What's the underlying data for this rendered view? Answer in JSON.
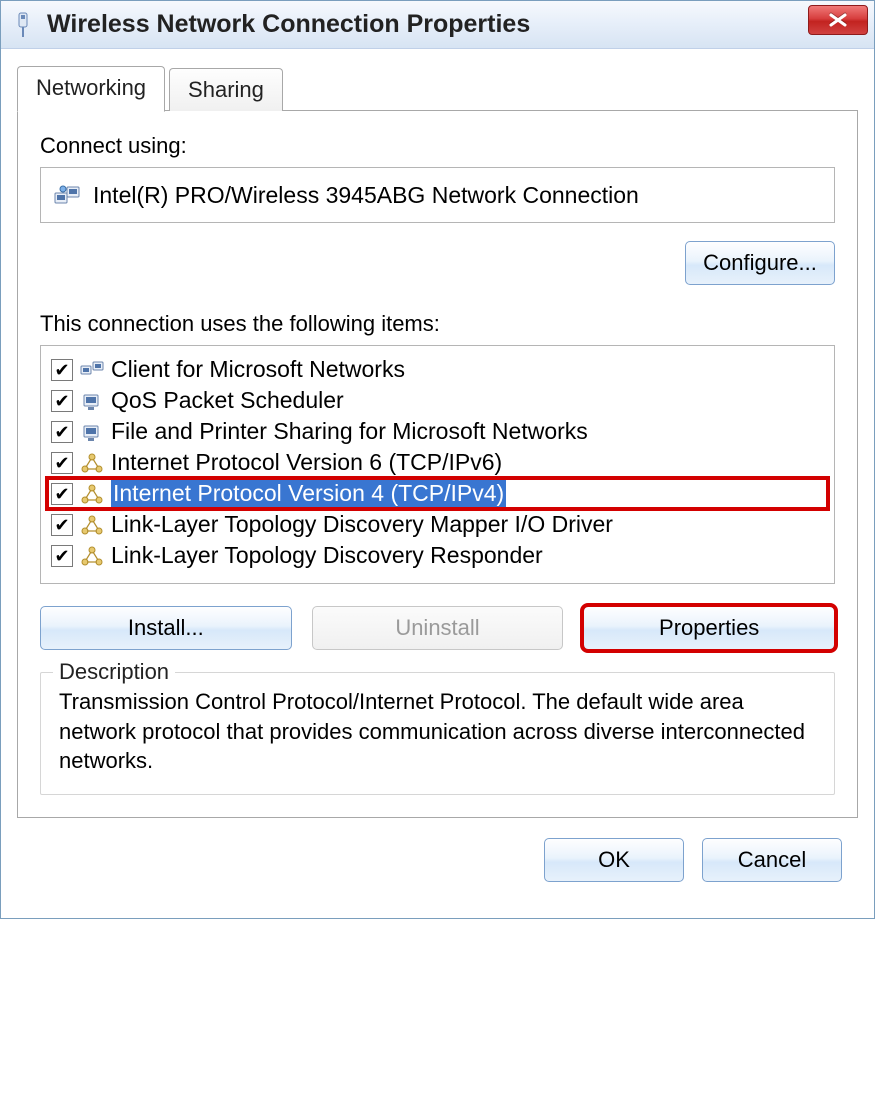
{
  "window": {
    "title": "Wireless Network Connection Properties"
  },
  "tabs": {
    "networking": "Networking",
    "sharing": "Sharing"
  },
  "connect_using_label": "Connect using:",
  "adapter_name": "Intel(R) PRO/Wireless 3945ABG Network Connection",
  "configure_label": "Configure...",
  "items_label": "This connection uses the following items:",
  "items": [
    {
      "label": "Client for Microsoft Networks",
      "checked": true,
      "icon": "client",
      "selected": false,
      "highlight": false
    },
    {
      "label": "QoS Packet Scheduler",
      "checked": true,
      "icon": "service",
      "selected": false,
      "highlight": false
    },
    {
      "label": "File and Printer Sharing for Microsoft Networks",
      "checked": true,
      "icon": "service",
      "selected": false,
      "highlight": false
    },
    {
      "label": "Internet Protocol Version 6 (TCP/IPv6)",
      "checked": true,
      "icon": "protocol",
      "selected": false,
      "highlight": false
    },
    {
      "label": "Internet Protocol Version 4 (TCP/IPv4)",
      "checked": true,
      "icon": "protocol",
      "selected": true,
      "highlight": true
    },
    {
      "label": "Link-Layer Topology Discovery Mapper I/O Driver",
      "checked": true,
      "icon": "protocol",
      "selected": false,
      "highlight": false
    },
    {
      "label": "Link-Layer Topology Discovery Responder",
      "checked": true,
      "icon": "protocol",
      "selected": false,
      "highlight": false
    }
  ],
  "install_label": "Install...",
  "uninstall_label": "Uninstall",
  "properties_label": "Properties",
  "description_legend": "Description",
  "description_text": "Transmission Control Protocol/Internet Protocol. The default wide area network protocol that provides communication across diverse interconnected networks.",
  "ok_label": "OK",
  "cancel_label": "Cancel"
}
